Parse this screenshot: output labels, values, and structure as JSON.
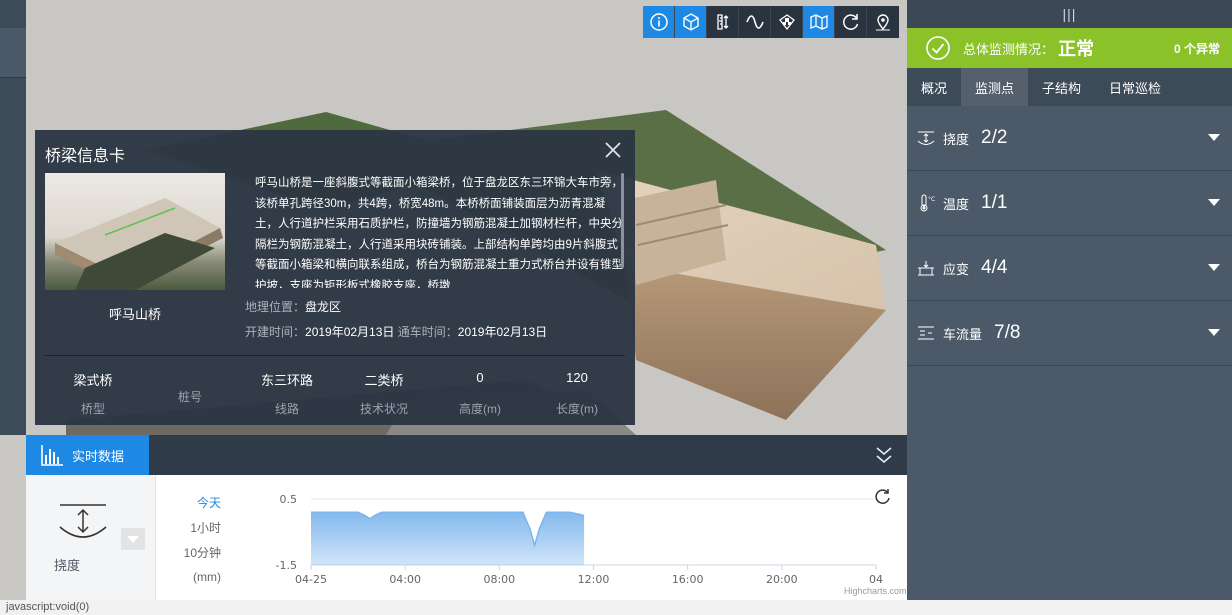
{
  "toolbar": {
    "icons": [
      "info-icon",
      "cube-icon",
      "measure-icon",
      "wave-icon",
      "grid-icon",
      "map-layer-icon",
      "refresh-icon",
      "location-icon"
    ]
  },
  "card": {
    "title": "桥梁信息卡",
    "name": "呼马山桥",
    "description": "呼马山桥是一座斜腹式等截面小箱梁桥，位于盘龙区东三环锦大车市旁，该桥单孔跨径30m，共4跨，桥宽48m。本桥桥面铺装面层为沥青混凝土，人行道护栏采用石质护栏，防撞墙为钢筋混凝土加钢材栏杆，中央分隔栏为钢筋混凝土，人行道采用块砖铺装。上部结构单跨均由9片斜腹式等截面小箱梁和横向联系组成，桥台为钢筋混凝土重力式桥台并设有锥型护坡，支座为矩形板式橡胶支座，桥墩",
    "location_label": "地理位置：",
    "location_value": "盘龙区",
    "build_label": "开建时间：",
    "build_value": "2019年02月13日",
    "open_label": "通车时间：",
    "open_value": "2019年02月13日",
    "stats": [
      {
        "value": "梁式桥",
        "label": "桥型"
      },
      {
        "value": "",
        "label": "桩号"
      },
      {
        "value": "东三环路",
        "label": "线路"
      },
      {
        "value": "二类桥",
        "label": "技术状况"
      },
      {
        "value": "0",
        "label": "高度(m)"
      },
      {
        "value": "120",
        "label": "长度(m)"
      }
    ]
  },
  "realtime": {
    "tab_label": "实时数据",
    "sensor_label": "挠度",
    "ranges": [
      "今天",
      "1小时",
      "10分钟",
      "(mm)"
    ],
    "credit": "Highcharts.com"
  },
  "chart_data": {
    "type": "area",
    "title": "",
    "xlabel": "",
    "ylabel": "(mm)",
    "x_ticks": [
      "04-25",
      "04:00",
      "08:00",
      "12:00",
      "16:00",
      "20:00",
      "04"
    ],
    "y_ticks": [
      "0.5",
      "-1.5"
    ],
    "ylim": [
      -1.5,
      0.5
    ],
    "x_hours": [
      0,
      0.5,
      1,
      1.5,
      2,
      2.3,
      2.5,
      2.7,
      3,
      4,
      5,
      6,
      7,
      8,
      9,
      9.3,
      9.5,
      9.7,
      10,
      11,
      11.6
    ],
    "values": [
      0.1,
      0.1,
      0.1,
      0.1,
      0.1,
      0.0,
      -0.1,
      0.0,
      0.1,
      0.1,
      0.1,
      0.1,
      0.1,
      0.1,
      0.1,
      -0.4,
      -0.9,
      -0.4,
      0.1,
      0.1,
      0.0
    ],
    "color": "#7cb5ec",
    "grid": true
  },
  "statusbar": {
    "text": "javascript:void(0)"
  },
  "right_panel": {
    "handle": "|||",
    "status_label": "总体监测情况：",
    "status_value": "正常",
    "abnormal": "0 个异常",
    "status_color": "#8bc22a",
    "tabs": [
      {
        "label": "概况",
        "active": false
      },
      {
        "label": "监测点",
        "active": true
      },
      {
        "label": "子结构",
        "active": false
      },
      {
        "label": "日常巡检",
        "active": false
      }
    ],
    "rows": [
      {
        "icon": "deflection-icon",
        "label": "挠度",
        "value": "2/2"
      },
      {
        "icon": "thermometer-icon",
        "label": "温度",
        "value": "1/1"
      },
      {
        "icon": "strain-icon",
        "label": "应变",
        "value": "4/4"
      },
      {
        "icon": "traffic-icon",
        "label": "车流量",
        "value": "7/8"
      }
    ]
  }
}
